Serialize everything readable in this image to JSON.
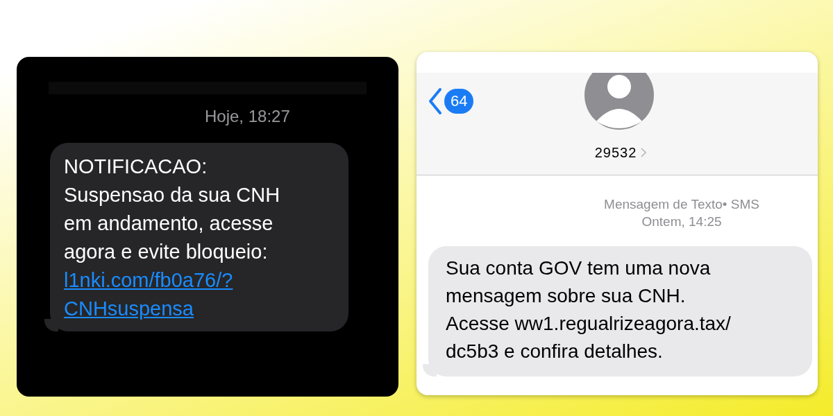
{
  "left_screen": {
    "timestamp": "Hoje, 18:27",
    "message": {
      "text": "NOTIFICACAO:\nSuspensao da sua CNH\nem andamento, acesse\nagora e evite bloqueio:",
      "link": "l1nki.com/fb0a76/?\nCNHsuspensa"
    }
  },
  "right_screen": {
    "header": {
      "back_count": "64",
      "contact": "29532"
    },
    "service_label": "Mensagem de Texto• SMS",
    "timestamp": "Ontem, 14:25",
    "message": {
      "text": "Sua conta GOV tem uma nova\nmensagem sobre sua CNH.\nAcesse ww1.regualrizeagora.tax/\ndc5b3 e confira detalhes."
    }
  }
}
